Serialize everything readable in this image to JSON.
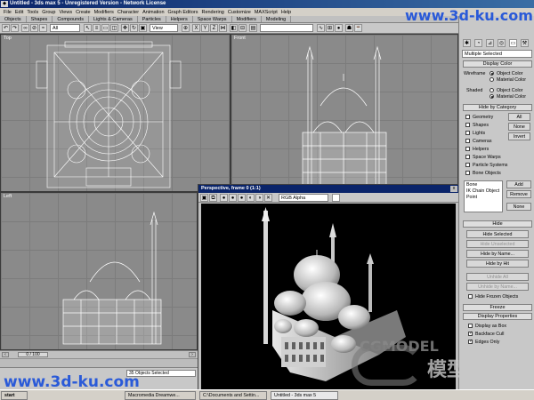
{
  "window": {
    "title": "Untitled - 3ds max 5 - Unregistered Version - Network License",
    "app_icon": "3ds-max-icon"
  },
  "menu": [
    "File",
    "Edit",
    "Tools",
    "Group",
    "Views",
    "Create",
    "Modifiers",
    "Character",
    "Animation",
    "Graph Editors",
    "Rendering",
    "Customize",
    "MAXScript",
    "Help"
  ],
  "tabs": [
    "Objects",
    "Shapes",
    "Compounds",
    "Lights & Cameras",
    "Particles",
    "Helpers",
    "Space Warps",
    "Modifiers",
    "Modeling"
  ],
  "toolbar": {
    "selection_filter": "All",
    "ref_coord": "View"
  },
  "viewports": {
    "top_left_label": "Top",
    "top_right_label": "Front",
    "bottom_left_label": "Left"
  },
  "render_window": {
    "title": "Perspective, frame 0 (1:1)",
    "channel": "RGB Alpha",
    "close": "x"
  },
  "command_panel": {
    "name_field": "Multiple Selected",
    "display_color": {
      "header": "Display Color",
      "wireframe_label": "Wireframe",
      "shaded_label": "Shaded",
      "object_color": "Object Color",
      "material_color": "Material Color"
    },
    "hide_by_category": {
      "header": "Hide by Category",
      "items": [
        "Geometry",
        "Shapes",
        "Lights",
        "Cameras",
        "Helpers",
        "Space Warps",
        "Particle Systems",
        "Bone Objects"
      ],
      "all": "All",
      "none": "None",
      "invert": "Invert",
      "list_items": [
        "Bone",
        "IK Chain Object",
        "Point"
      ],
      "add": "Add",
      "remove": "Remove",
      "none2": "None"
    },
    "hide": {
      "header": "Hide",
      "buttons": [
        "Hide Selected",
        "Hide Unselected",
        "Hide by Name...",
        "Hide by Hit",
        "Unhide All",
        "Unhide by Name..."
      ],
      "frozen": "Hide Frozen Objects"
    },
    "freeze": {
      "header": "Freeze"
    },
    "display_properties": {
      "header": "Display Properties",
      "items": [
        "Display as Box",
        "Backface Cull",
        "Edges Only"
      ]
    }
  },
  "timeslider": {
    "frame": "0 / 100"
  },
  "status": {
    "selected": "35 Objects Selected"
  },
  "taskbar": {
    "start": "start",
    "items": [
      "Macromedia Dreamwe...",
      "C:\\Documents and Settin...",
      "Untitled - 3ds max 5"
    ]
  },
  "watermarks": {
    "top": "www.3d-ku.com",
    "bottom": "www.3d-ku.com",
    "cgmodel": "CGMODEL",
    "cn": "模型网"
  }
}
